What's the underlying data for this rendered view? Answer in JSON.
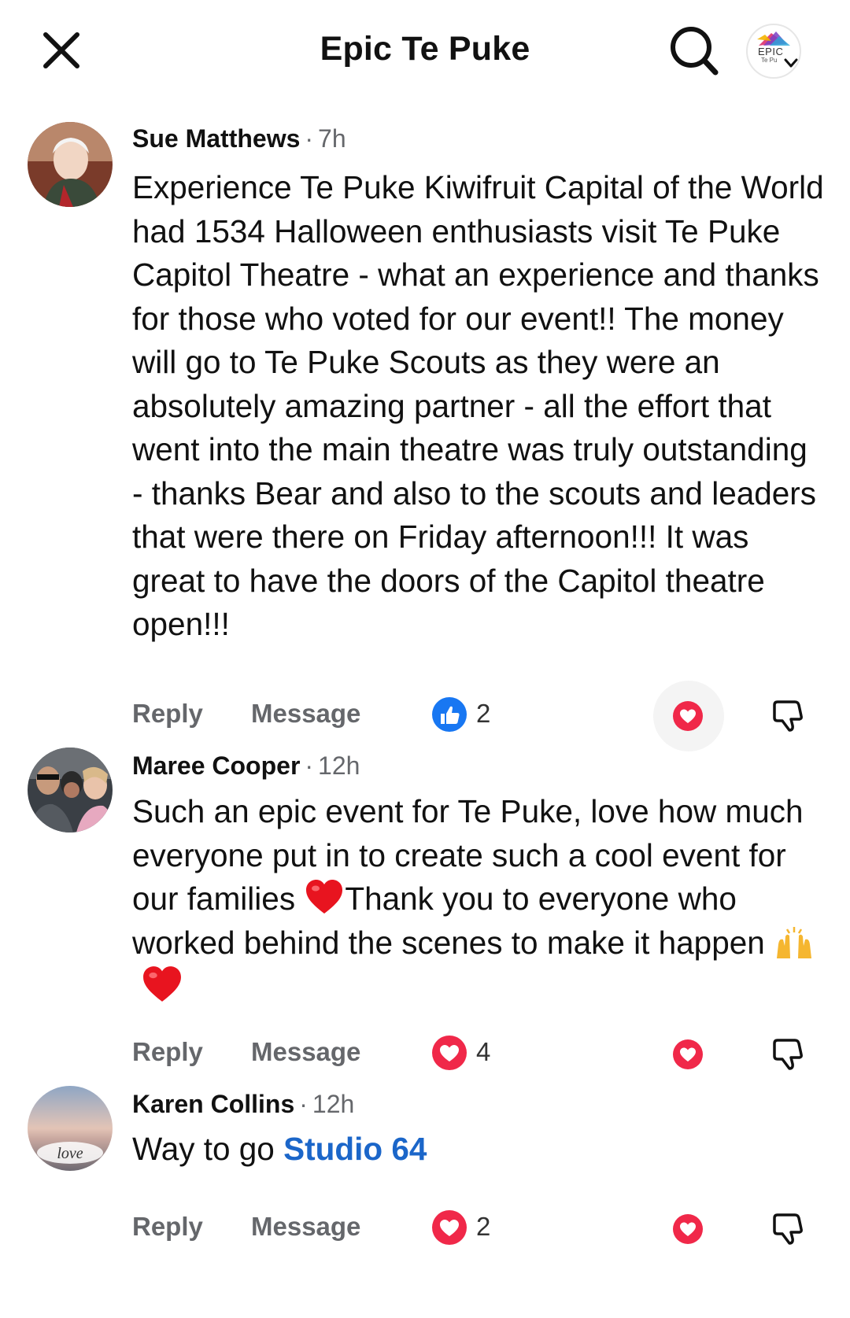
{
  "header": {
    "title": "Epic Te Puke",
    "page_logo_text": "EPIC",
    "page_logo_sub": "Te Pu"
  },
  "comments": [
    {
      "name": "Sue Matthews",
      "dot": "·",
      "time": "7h",
      "text": "Experience Te Puke Kiwifruit Capital of the World had 1534 Halloween enthusiasts visit Te Puke Capitol Theatre - what an experience and thanks for those who voted for our event!! The money will go to Te Puke Scouts as they were an absolutely amazing partner - all the effort that went into the main theatre was truly outstanding - thanks Bear and also to the scouts and leaders that were there on Friday afternoon!!!  It was great to have the doors of the Capitol theatre open!!!",
      "reply_label": "Reply",
      "message_label": "Message",
      "reaction_type": "like",
      "reaction_count": "2"
    },
    {
      "name": "Maree Cooper",
      "dot": "·",
      "time": "12h",
      "text_part1": "Such an epic event for Te Puke, love how much everyone put in to create such a cool event for our families ",
      "text_part2": "Thank you to everyone who worked behind the scenes to make it happen ",
      "reply_label": "Reply",
      "message_label": "Message",
      "reaction_type": "love",
      "reaction_count": "4"
    },
    {
      "name": "Karen Collins",
      "dot": "·",
      "time": "12h",
      "text_prefix": "Way to go ",
      "mention": "Studio 64",
      "avatar_text": "love",
      "reply_label": "Reply",
      "message_label": "Message",
      "reaction_type": "love",
      "reaction_count": "2"
    }
  ],
  "colors": {
    "like_blue": "#1877f2",
    "love_red": "#f02849",
    "mention_blue": "#1b66c9",
    "meta_gray": "#65676b"
  }
}
